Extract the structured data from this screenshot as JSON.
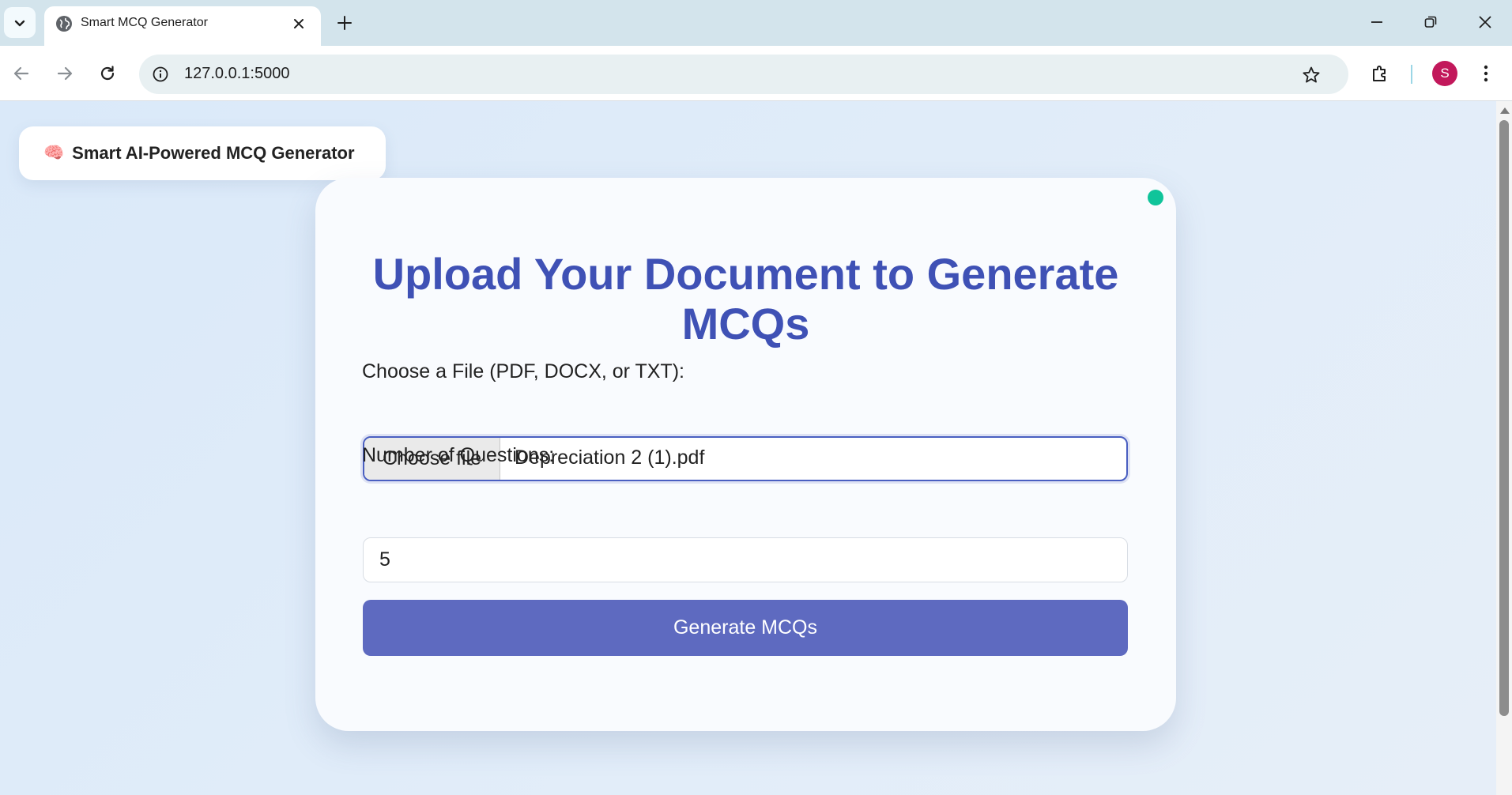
{
  "browser": {
    "tab_title": "Smart MCQ Generator",
    "url": "127.0.0.1:5000",
    "profile_initial": "S"
  },
  "page": {
    "brand_emoji": "🧠",
    "brand_title": "Smart AI-Powered MCQ Generator",
    "heading": "Upload Your Document to Generate MCQs",
    "file_label": "Choose a File (PDF, DOCX, or TXT):",
    "choose_button": "Choose file",
    "file_name": "Depreciation 2 (1).pdf",
    "num_label": "Number of Questions:",
    "num_value": "5",
    "generate_button": "Generate MCQs"
  },
  "colors": {
    "accent": "#3f51b5",
    "button": "#5e6ac0",
    "status_dot": "#10c49a",
    "avatar": "#c2185b"
  },
  "icons": [
    "tab-search-icon",
    "globe-icon",
    "close-icon",
    "plus-icon",
    "minimize-icon",
    "restore-icon",
    "back-icon",
    "forward-icon",
    "reload-icon",
    "info-icon",
    "star-icon",
    "extensions-icon",
    "kebab-menu-icon"
  ]
}
